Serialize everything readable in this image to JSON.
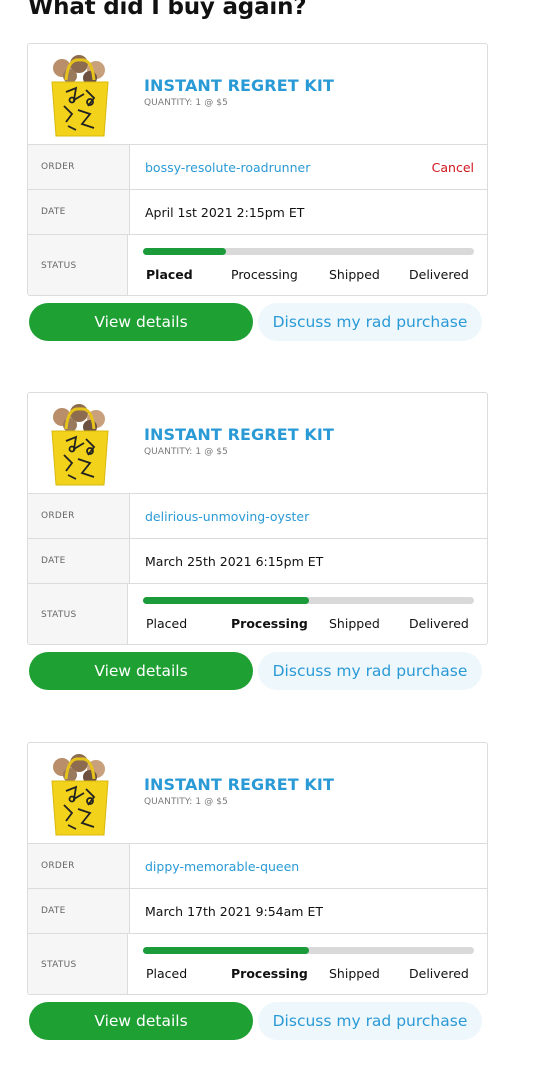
{
  "page": {
    "title": "What did I buy again?"
  },
  "colors": {
    "link": "#2a9ad6",
    "cancel": "#d0161e",
    "primary_button": "#1fa033",
    "progress": "#1b9b3a"
  },
  "labels": {
    "order": "ORDER",
    "date": "DATE",
    "status": "STATUS"
  },
  "orders": [
    {
      "product_name": "INSTANT REGRET KIT",
      "quantity": "QUANTITY: 1 @ $5",
      "order_id": "bossy-resolute-roadrunner",
      "cancel": "Cancel",
      "date": "April 1st 2021 2:15pm ET",
      "stages": [
        "Placed",
        "Processing",
        "Shipped",
        "Delivered"
      ],
      "current_stage": "Placed",
      "progress_fraction": 0.25,
      "view_details": "View details",
      "discuss": "Discuss my rad purchase"
    },
    {
      "product_name": "INSTANT REGRET KIT",
      "quantity": "QUANTITY: 1 @ $5",
      "order_id": "delirious-unmoving-oyster",
      "cancel": "",
      "date": "March 25th 2021 6:15pm ET",
      "stages": [
        "Placed",
        "Processing",
        "Shipped",
        "Delivered"
      ],
      "current_stage": "Processing",
      "progress_fraction": 0.5,
      "view_details": "View details",
      "discuss": "Discuss my rad purchase"
    },
    {
      "product_name": "INSTANT REGRET KIT",
      "quantity": "QUANTITY: 1 @ $5",
      "order_id": "dippy-memorable-queen",
      "cancel": "",
      "date": "March 17th 2021 9:54am ET",
      "stages": [
        "Placed",
        "Processing",
        "Shipped",
        "Delivered"
      ],
      "current_stage": "Processing",
      "progress_fraction": 0.5,
      "view_details": "View details",
      "discuss": "Discuss my rad purchase"
    }
  ]
}
